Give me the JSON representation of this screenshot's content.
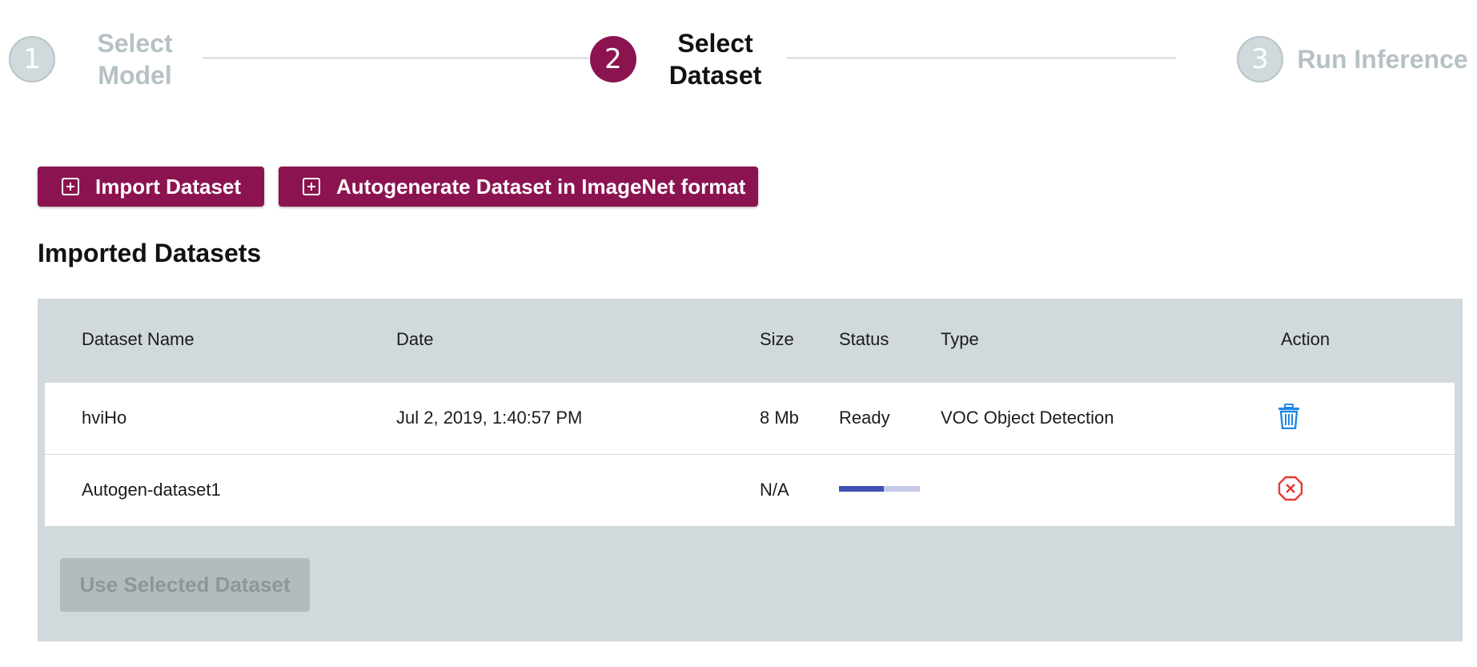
{
  "stepper": {
    "steps": [
      {
        "number": "1",
        "label_line1": "Select",
        "label_line2": "Model",
        "state": "inactive"
      },
      {
        "number": "2",
        "label_line1": "Select",
        "label_line2": "Dataset",
        "state": "active"
      },
      {
        "number": "3",
        "label_line1": "Run Inference",
        "label_line2": "",
        "state": "inactive"
      }
    ]
  },
  "actions": {
    "import_label": "Import Dataset",
    "autogen_label": "Autogenerate Dataset in ImageNet format"
  },
  "section_title": "Imported Datasets",
  "table": {
    "headers": {
      "name": "Dataset Name",
      "date": "Date",
      "size": "Size",
      "status": "Status",
      "type": "Type",
      "action": "Action"
    },
    "rows": [
      {
        "name": "hviHo",
        "date": "Jul 2, 2019, 1:40:57 PM",
        "size": "8 Mb",
        "status": "Ready",
        "type": "VOC Object Detection",
        "action_icon": "trash-icon"
      },
      {
        "name": "Autogen-dataset1",
        "date": "",
        "size": "N/A",
        "status": "",
        "progress": 0.55,
        "type": "",
        "action_icon": "cancel-icon"
      }
    ]
  },
  "use_button_label": "Use Selected Dataset",
  "colors": {
    "brand": "#8b1450",
    "panel": "#d1d9dc",
    "progress": "#3f51b5",
    "trash": "#1e88e5",
    "cancel": "#e53935"
  }
}
